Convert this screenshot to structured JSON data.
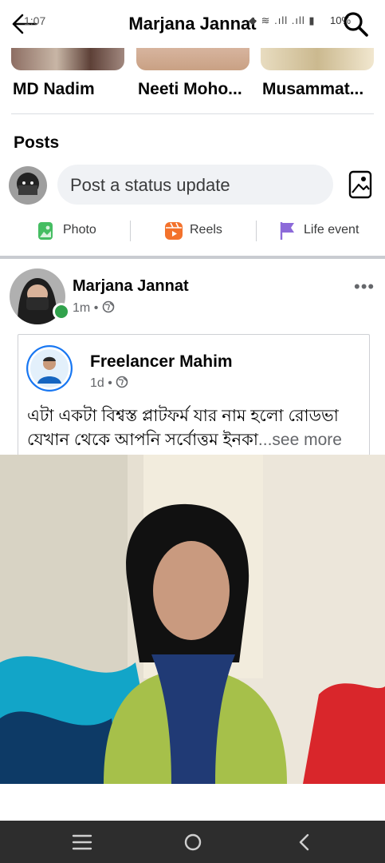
{
  "status_bar": {
    "time": "1:07",
    "signal_text": "◆ ≋ .ıll .ıll ▮",
    "battery": "10%"
  },
  "header": {
    "title": "Marjana Jannat"
  },
  "friends": [
    {
      "name": "MD Nadim"
    },
    {
      "name": "Neeti Moho..."
    },
    {
      "name": "Musammat..."
    }
  ],
  "posts_section": {
    "heading": "Posts",
    "status_placeholder": "Post a status update",
    "actions": [
      {
        "label": "Photo",
        "icon": "photo-icon",
        "color": "#45bd62"
      },
      {
        "label": "Reels",
        "icon": "reels-icon",
        "color": "#f3722c"
      },
      {
        "label": "Life event",
        "icon": "flag-icon",
        "color": "#8c6ad9"
      }
    ]
  },
  "post": {
    "author": "Marjana Jannat",
    "time": "1m",
    "privacy_icon": "globe-icon",
    "more_label": "•••",
    "shared": {
      "author": "Freelancer Mahim",
      "time": "1d",
      "privacy_icon": "globe-icon",
      "text_line1": "এটা একটা বিশ্বস্ত প্লাটফর্ম যার নাম হলো রোডভা",
      "text_line2": "যেখান থেকে আপনি সর্বোত্তম ইনকা",
      "see_more": "...see more"
    }
  },
  "colors": {
    "online": "#31a24c",
    "input_bg": "#f0f2f5",
    "secondary_text": "#65676b"
  },
  "system_nav": {
    "icons": [
      "recent-apps-icon",
      "home-icon",
      "back-icon"
    ]
  }
}
